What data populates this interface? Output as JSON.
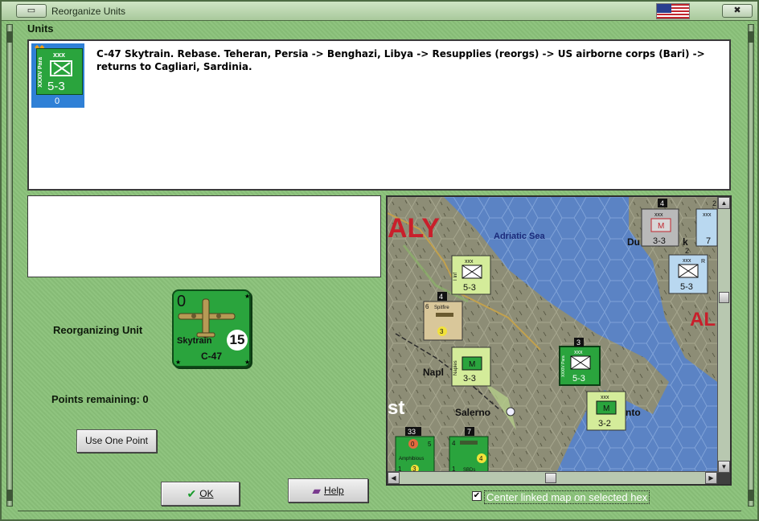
{
  "window": {
    "title": "Reorganize Units",
    "colors": {
      "frame": "#8fc47f",
      "titlebar": "#b9d5ad",
      "counter_green": "#2aa43d",
      "selected_blue": "#2f80d6"
    }
  },
  "units": {
    "heading": "Units",
    "list": [
      {
        "tag": "xxx",
        "name": "XXXIV Para",
        "strength": "5-3",
        "count": "0"
      }
    ],
    "description": "C-47 Skytrain.  Rebase.  Teheran, Persia -> Benghazi, Libya -> Resupplies (reorgs) -> US airborne corps (Bari) -> returns to Cagliari, Sardinia."
  },
  "reorganizing": {
    "label": "Reorganizing Unit",
    "unit": {
      "top_left": "0",
      "name": "Skytrain",
      "type": "C-47",
      "range": "15"
    },
    "points_label": "Points remaining:  0",
    "use_one_point_label": "Use One Point"
  },
  "buttons": {
    "ok_label": "OK",
    "ok_icon": "check-icon",
    "help_label": "Help",
    "help_icon": "book-icon"
  },
  "map": {
    "labels": {
      "country_west": "ALY",
      "country_east": "AL",
      "sea": "Adriatic Sea",
      "city_naples": "Napl",
      "city_salerno": "Salerno",
      "city_taranto": "nto",
      "city_dubrovnik": "Du",
      "city_dubrovnik_tail": "k",
      "city_west": "st"
    },
    "units": [
      {
        "tag": "xxx",
        "name": "I Inf",
        "strength": "5-3",
        "color": "#d4ec9a"
      },
      {
        "tag": "",
        "name": "Spitfire",
        "strength": "3",
        "stack": "4",
        "top": "6",
        "color": "#d9c79a"
      },
      {
        "tag": "",
        "name": "Naples",
        "strength": "3-3",
        "stack": "",
        "marker": "M",
        "color": "#d4ec9a"
      },
      {
        "tag": "xxx",
        "name": "XXXIV Para",
        "strength": "5-3",
        "stack": "3",
        "color": "#2aa43d"
      },
      {
        "tag": "xxx",
        "name": "Italian",
        "strength": "3-2",
        "marker": "M",
        "color": "#d4ec9a"
      },
      {
        "tag": "xxx",
        "name": "Zagreb",
        "strength": "3-3",
        "stack": "4",
        "marker": "M",
        "color": "#b9b9b9"
      },
      {
        "tag": "xxx",
        "name": "XXVII Inf",
        "strength": "7",
        "stack": "2",
        "color": "#b9d8f0"
      },
      {
        "tag": "xxx",
        "name": "VIII Inf",
        "strength": "5-3",
        "stack": "2",
        "marker": "R",
        "color": "#b9d8f0"
      },
      {
        "tag": "",
        "name": "Amphibious",
        "strength": "5",
        "stack": "33",
        "top": "0",
        "bottom": "1",
        "bottom_mid": "3",
        "color": "#2aa43d"
      },
      {
        "tag": "",
        "name": "SBDs",
        "strength": "4",
        "stack": "7",
        "top": "4",
        "bottom": "1",
        "color": "#2aa43d"
      }
    ]
  },
  "center_option": {
    "label": "Center linked map on selected hex",
    "checked": "✔"
  }
}
